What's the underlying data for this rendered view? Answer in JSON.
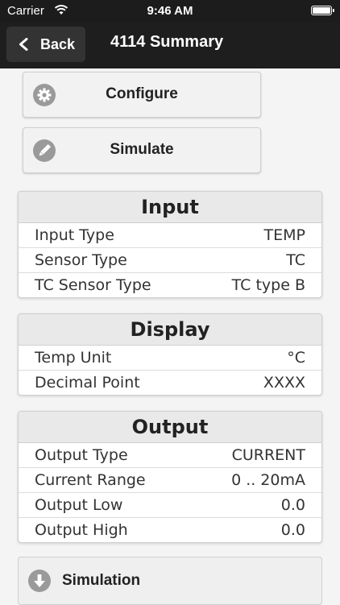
{
  "status_bar": {
    "carrier": "Carrier",
    "time": "9:46 AM"
  },
  "nav": {
    "back_label": "Back",
    "title": "4114 Summary"
  },
  "actions": {
    "configure": "Configure",
    "simulate": "Simulate"
  },
  "input": {
    "title": "Input",
    "rows": [
      {
        "label": "Input Type",
        "value": "TEMP"
      },
      {
        "label": "Sensor Type",
        "value": "TC"
      },
      {
        "label": "TC Sensor Type",
        "value": "TC type B"
      }
    ]
  },
  "display": {
    "title": "Display",
    "rows": [
      {
        "label": "Temp Unit",
        "value": "°C"
      },
      {
        "label": "Decimal Point",
        "value": "XXXX"
      }
    ]
  },
  "output": {
    "title": "Output",
    "rows": [
      {
        "label": "Output Type",
        "value": "CURRENT"
      },
      {
        "label": "Current Range",
        "value": "0 .. 20mA"
      },
      {
        "label": "Output Low",
        "value": "0.0"
      },
      {
        "label": "Output High",
        "value": "0.0"
      }
    ]
  },
  "simulation": {
    "label": "Simulation"
  },
  "icons": {
    "configure": "gear-icon",
    "simulate": "pencil-icon",
    "simulation": "arrow-down-circle-icon",
    "back": "chevron-left-icon"
  },
  "colors": {
    "nav_background": "#1e1e1e",
    "icon_gray": "#9a9a9a"
  }
}
